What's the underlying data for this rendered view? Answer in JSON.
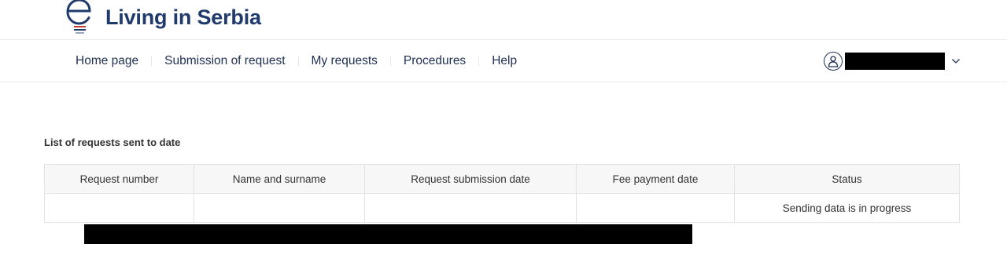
{
  "header": {
    "logo_text": "Living in Serbia",
    "logo_icon": "e-logo-icon"
  },
  "nav": {
    "items": [
      {
        "label": "Home page"
      },
      {
        "label": "Submission of request"
      },
      {
        "label": "My requests"
      },
      {
        "label": "Procedures"
      },
      {
        "label": "Help"
      }
    ],
    "user": {
      "icon": "user-icon",
      "name_redacted": true,
      "dropdown_icon": "chevron-down-icon"
    }
  },
  "main": {
    "title": "List of requests sent to date",
    "table": {
      "columns": [
        "Request number",
        "Name and surname",
        "Request submission date",
        "Fee payment date",
        "Status"
      ],
      "rows": [
        {
          "status": "Sending data is in progress"
        }
      ]
    }
  },
  "colors": {
    "brand": "#1f3a6b",
    "logo_accent": "#c0392b",
    "nav_text": "#1f2f52",
    "table_header_bg": "#f7f7f7",
    "border": "#e2e2e2"
  }
}
